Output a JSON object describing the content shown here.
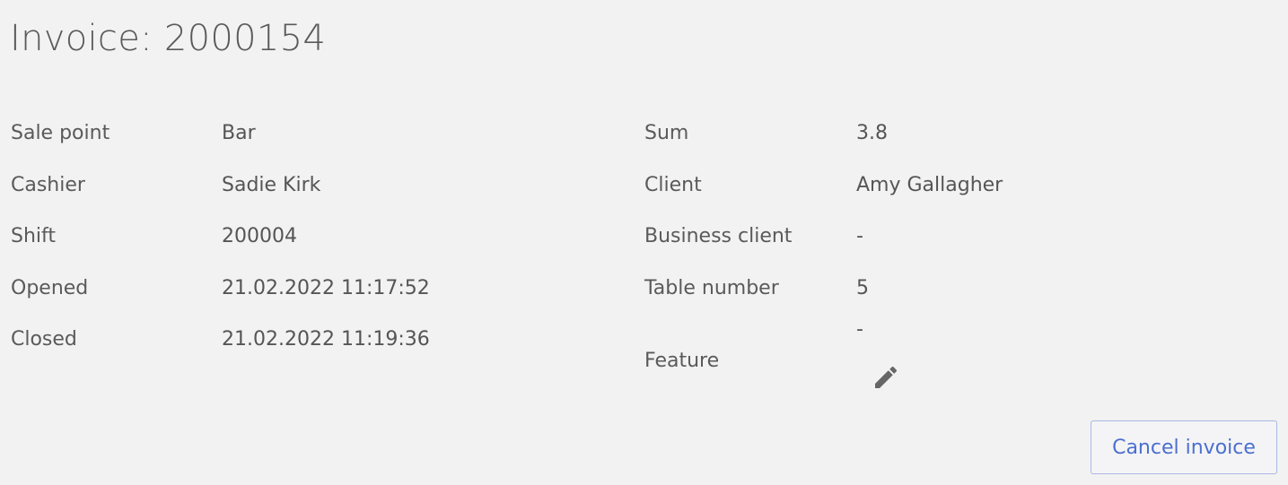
{
  "invoice": {
    "title": "Invoice: 2000154"
  },
  "details_left": [
    {
      "label": "Sale point",
      "value": "Bar"
    },
    {
      "label": "Cashier",
      "value": "Sadie Kirk"
    },
    {
      "label": "Shift",
      "value": "200004"
    },
    {
      "label": "Opened",
      "value": "21.02.2022 11:17:52"
    },
    {
      "label": "Closed",
      "value": "21.02.2022 11:19:36"
    }
  ],
  "details_right": [
    {
      "label": "Sum",
      "value": "3.8"
    },
    {
      "label": "Client",
      "value": "Amy Gallagher"
    },
    {
      "label": "Business client",
      "value": "-"
    },
    {
      "label": "Table number",
      "value": "5"
    },
    {
      "label": "Feature",
      "value": "-"
    }
  ],
  "feature": {
    "edit_icon": "pencil-icon"
  },
  "actions": {
    "cancel_label": "Cancel invoice"
  },
  "colors": {
    "background": "#f2f2f2",
    "text": "#555555",
    "accent": "#4b6fd0",
    "button_border": "#a9b6e4"
  }
}
